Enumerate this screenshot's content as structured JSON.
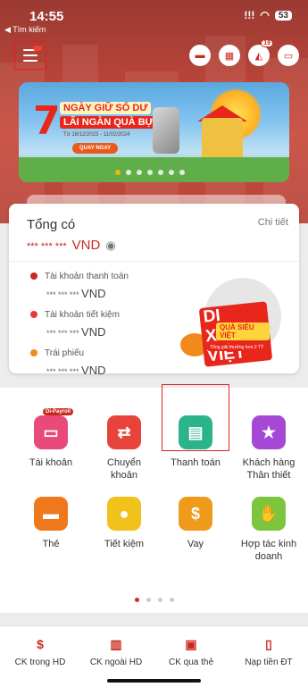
{
  "status_bar": {
    "time": "14:55",
    "back_label": "◀ Tìm kiếm",
    "signal": "!!!",
    "wifi": "◠",
    "battery": "53"
  },
  "top_actions": {
    "notification_count": "19"
  },
  "banner": {
    "big_number": "7",
    "line1": "NGÀY GIỮ SỐ DƯ",
    "line2": "LÃI NGÀN QUÀ BỰ",
    "date": "Từ 18/12/2023 - 11/02/2024",
    "cta": "QUAY NGAY",
    "slide_count": 7,
    "active_slide": 0
  },
  "balance_card": {
    "title": "Tổng có",
    "detail_link": "Chi tiết",
    "masked_total": "*** *** ***",
    "currency": "VND",
    "accounts": [
      {
        "label": "Tài khoản thanh toán",
        "masked": "*** *** ***",
        "currency": "VND",
        "color": "#c8281e"
      },
      {
        "label": "Tài khoản tiết kiệm",
        "masked": "*** *** ***",
        "currency": "VND",
        "color": "#e53935"
      },
      {
        "label": "Trái phiếu",
        "masked": "*** *** ***",
        "currency": "VND",
        "color": "#f08a1c"
      }
    ],
    "promo": {
      "title": "DI XUYÊN VIỆT",
      "subtitle": "QUÀ SIÊU VIỆT",
      "caption": "Tổng giải thưởng hơn 2 TỶ"
    }
  },
  "services": [
    {
      "label": "Tài khoản",
      "tag": "Di-Payroll",
      "icon": "wallet-icon",
      "color": "#e84b7a"
    },
    {
      "label": "Chuyển khoản",
      "tag": "",
      "icon": "transfer-icon",
      "color": "#e8433a"
    },
    {
      "label": "Thanh toán",
      "tag": "",
      "icon": "bill-icon",
      "color": "#2bb48a"
    },
    {
      "label": "Khách hàng Thân thiết",
      "tag": "",
      "icon": "star-icon",
      "color": "#a548d6"
    },
    {
      "label": "Thẻ",
      "tag": "",
      "icon": "card-icon",
      "color": "#f0781c"
    },
    {
      "label": "Tiết kiệm",
      "tag": "",
      "icon": "piggy-icon",
      "color": "#f2c21c"
    },
    {
      "label": "Vay",
      "tag": "",
      "icon": "dollar-icon",
      "color": "#f09a1c"
    },
    {
      "label": "Hợp tác kinh doanh",
      "tag": "",
      "icon": "handshake-icon",
      "color": "#7cc53c"
    }
  ],
  "service_pager": {
    "count": 4,
    "active": 0
  },
  "bottom_tabs": [
    {
      "label": "CK trong HD",
      "icon": "dollar-transfer-icon"
    },
    {
      "label": "CK ngoài HD",
      "icon": "bank-icon"
    },
    {
      "label": "CK qua thẻ",
      "icon": "card-transfer-icon"
    },
    {
      "label": "Nạp tiền ĐT",
      "icon": "phone-topup-icon"
    }
  ],
  "colors": {
    "brand_red": "#c8281e",
    "highlight_border": "#e02020"
  }
}
